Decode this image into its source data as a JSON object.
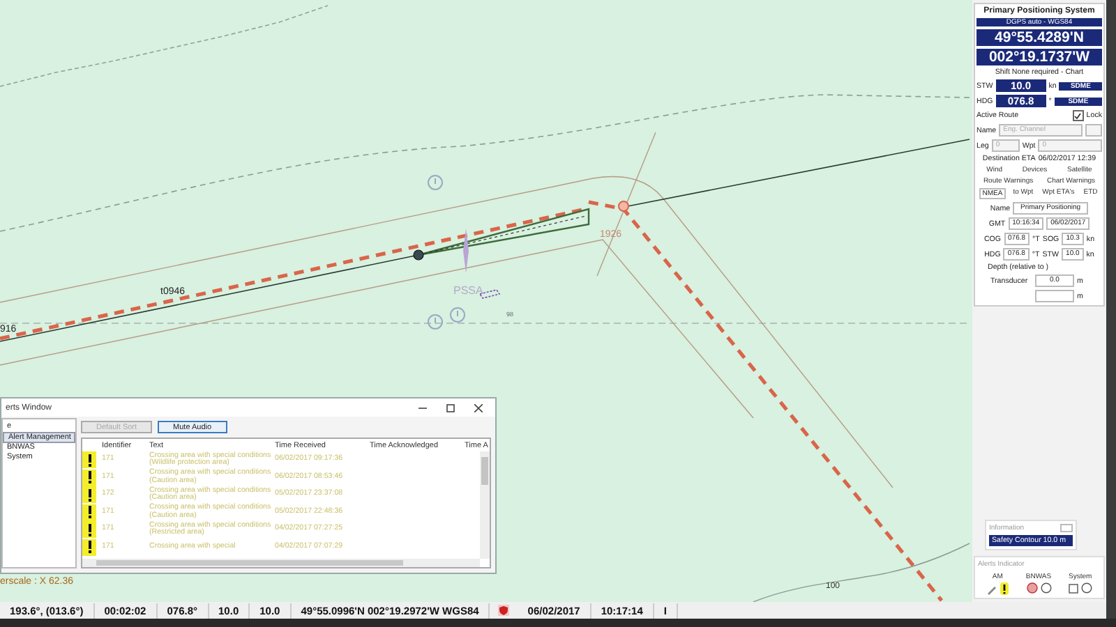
{
  "chart": {
    "route_labels": [
      "916",
      "t0946",
      "1926"
    ],
    "area_label": "PSSA",
    "sounding": "98",
    "contour_label": "100",
    "scale": "erscale : X 62.36"
  },
  "alerts_window": {
    "title": "erts Window",
    "tree": [
      {
        "label": "e",
        "selected": false
      },
      {
        "label": "Alert Management",
        "selected": true
      },
      {
        "label": "BNWAS",
        "selected": false
      },
      {
        "label": "System",
        "selected": false
      }
    ],
    "buttons": [
      {
        "label": "Default Sort",
        "disabled": true
      },
      {
        "label": "Mute Audio",
        "disabled": false
      }
    ],
    "columns": [
      "Identifier",
      "Text",
      "Time Received",
      "Time Acknowledged",
      "Time A"
    ],
    "rows": [
      {
        "id": "171",
        "text": "Crossing area with special conditions (Wildlife protection area)",
        "received": "06/02/2017 09:17:36"
      },
      {
        "id": "171",
        "text": "Crossing area with special conditions (Caution area)",
        "received": "06/02/2017 08:53:46"
      },
      {
        "id": "172",
        "text": "Crossing area with special conditions (Caution area)",
        "received": "05/02/2017 23:37:08"
      },
      {
        "id": "171",
        "text": "Crossing area with special conditions (Caution area)",
        "received": "05/02/2017 22:48:36"
      },
      {
        "id": "171",
        "text": "Crossing area with special conditions (Restricted area)",
        "received": "04/02/2017 07:27:25"
      },
      {
        "id": "171",
        "text": "Crossing area with special",
        "received": "04/02/2017 07:07:29"
      }
    ]
  },
  "positioning_panel": {
    "title": "Primary Positioning System",
    "source": "DGPS auto - WGS84",
    "latitude": "49°55.4289'N",
    "longitude": "002°19.1737'W",
    "shift": "Shift None required - Chart",
    "readouts": [
      {
        "label": "STW",
        "value": "10.0",
        "unit": "kn",
        "sensor": "SDME"
      },
      {
        "label": "HDG",
        "value": "076.8",
        "unit": "°",
        "sensor": "SDME"
      }
    ],
    "active_route": "Active Route",
    "lock": {
      "label": "Lock",
      "checked": true
    },
    "name_label": "Name",
    "route_name": "Eng. Channel",
    "leg_label": "Leg",
    "leg": "0",
    "wpt_label": "Wpt",
    "wpt": "0",
    "eta_label": "Destination ETA",
    "eta": "06/02/2017 12:39",
    "tabs": [
      [
        {
          "label": "Wind",
          "selected": false
        },
        {
          "label": "Devices",
          "selected": false
        },
        {
          "label": "Satellite",
          "selected": false
        }
      ],
      [
        {
          "label": "Route Warnings",
          "selected": false
        },
        {
          "label": "Chart Warnings",
          "selected": false
        }
      ],
      [
        {
          "label": "NMEA",
          "selected": true
        },
        {
          "label": "to Wpt",
          "selected": false
        },
        {
          "label": "Wpt ETA's",
          "selected": false
        },
        {
          "label": "ETD",
          "selected": false
        }
      ]
    ],
    "device_label": "Name",
    "device": "Primary Positioning",
    "gmt_label": "GMT",
    "gmt_time": "10:16:34",
    "gmt_date": "06/02/2017",
    "motion": [
      {
        "label": "COG",
        "value": "076.8",
        "unit": "°T",
        "label2": "SOG",
        "value2": "10.3",
        "unit2": "kn"
      },
      {
        "label": "HDG",
        "value": "076.8",
        "unit": "°T",
        "label2": "STW",
        "value2": "10.0",
        "unit2": "kn"
      }
    ],
    "depth_title": "Depth (relative to )",
    "depth_rows": [
      {
        "label": "Transducer",
        "value": "0.0",
        "unit": "m"
      },
      {
        "unit": "m"
      }
    ]
  },
  "information": {
    "title": "Information",
    "message": "Safety Contour 10.0 m"
  },
  "alerts_indicator": {
    "title": "Alerts Indicator",
    "groups": [
      "AM",
      "BNWAS",
      "System"
    ]
  },
  "status_bar": [
    {
      "kind": "text",
      "text": "193.6°, (013.6°)"
    },
    {
      "kind": "text",
      "text": "00:02:02"
    },
    {
      "kind": "text",
      "text": "076.8°"
    },
    {
      "kind": "text",
      "text": "10.0"
    },
    {
      "kind": "text",
      "text": "10.0"
    },
    {
      "kind": "text",
      "text": "49°55.0996'N 002°19.2972'W WGS84"
    },
    {
      "kind": "shield"
    },
    {
      "kind": "text",
      "text": "06/02/2017"
    },
    {
      "kind": "text",
      "text": "10:17:14"
    },
    {
      "kind": "text",
      "text": "I"
    }
  ]
}
